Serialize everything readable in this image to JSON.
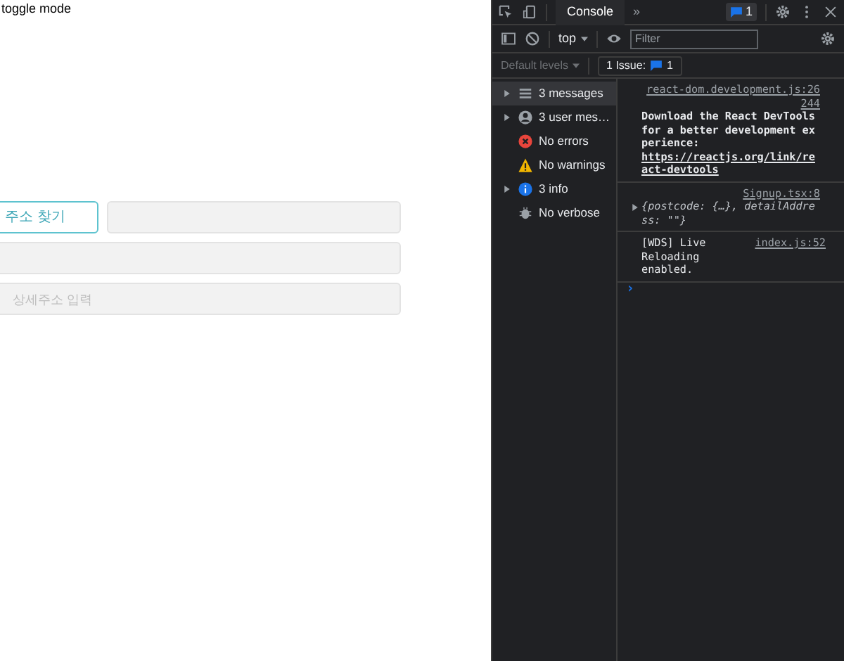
{
  "page": {
    "heading": "toggle mode",
    "search_button": "주소 찾기",
    "detail_field": {
      "placeholder": "상세주소 입력"
    }
  },
  "devtools": {
    "tabs": [
      {
        "label": "Console",
        "selected": true
      }
    ],
    "more_tabs": "»",
    "issues_badge": "1",
    "context": "top",
    "filter": {
      "placeholder": "Filter"
    },
    "levels": "Default levels",
    "issues": {
      "label": "1 Issue:",
      "count": "1"
    },
    "sidebar": [
      {
        "kind": "messages",
        "label": "3 messages",
        "expandable": true,
        "selected": true
      },
      {
        "kind": "user",
        "label": "3 user mes…",
        "expandable": true,
        "selected": false
      },
      {
        "kind": "errors",
        "label": "No errors",
        "expandable": false,
        "selected": false
      },
      {
        "kind": "warnings",
        "label": "No warnings",
        "expandable": false,
        "selected": false
      },
      {
        "kind": "info",
        "label": "3 info",
        "expandable": true,
        "selected": false
      },
      {
        "kind": "verbose",
        "label": "No verbose",
        "expandable": false,
        "selected": false
      }
    ],
    "messages": [
      {
        "kind": "text",
        "source": "react-dom.development.js:26244",
        "text": "Download the React DevTools for a better development experience: ",
        "link": "https://reactjs.org/link/react-devtools"
      },
      {
        "kind": "object",
        "source": "Signup.tsx:8",
        "text": "{postcode: {…}, detailAddress: \"\"}"
      },
      {
        "kind": "inline",
        "source": "index.js:52",
        "text": "[WDS] Live Reloading enabled."
      }
    ],
    "prompt": "›"
  }
}
